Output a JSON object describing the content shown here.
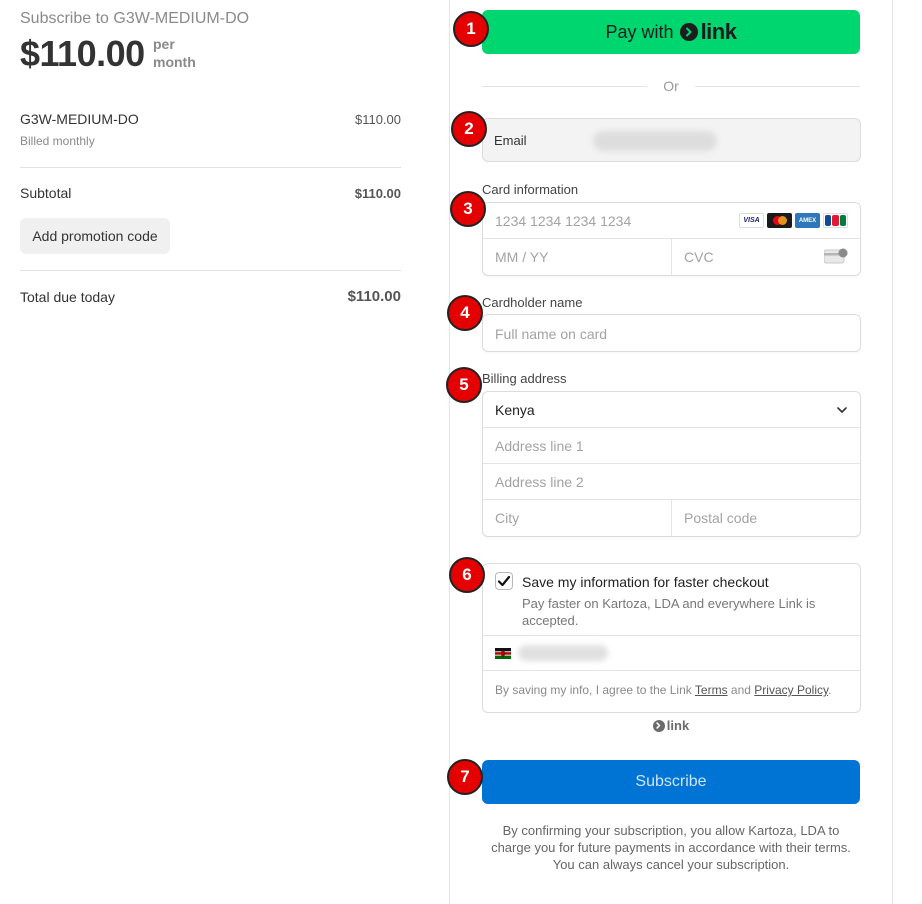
{
  "summary": {
    "subscribe_title": "Subscribe to G3W-MEDIUM-DO",
    "price": "$110.00",
    "per_line1": "per",
    "per_line2": "month",
    "item_name": "G3W-MEDIUM-DO",
    "item_billed": "Billed monthly",
    "item_amount": "$110.00",
    "subtotal_label": "Subtotal",
    "subtotal_amount": "$110.00",
    "promo_button": "Add promotion code",
    "total_label": "Total due today",
    "total_amount": "$110.00"
  },
  "payment": {
    "pay_with": "Pay with",
    "link_word": "link",
    "or_text": "Or",
    "email_label": "Email",
    "card_label": "Card information",
    "card_number_placeholder": "1234 1234 1234 1234",
    "expiry_placeholder": "MM / YY",
    "cvc_placeholder": "CVC",
    "card_brands": [
      "VISA",
      "mastercard",
      "AMEX",
      "JCB"
    ],
    "cardholder_label": "Cardholder name",
    "cardholder_placeholder": "Full name on card",
    "billing_label": "Billing address",
    "country_value": "Kenya",
    "address1_placeholder": "Address line 1",
    "address2_placeholder": "Address line 2",
    "city_placeholder": "City",
    "postal_placeholder": "Postal code",
    "save_checked": true,
    "save_title": "Save my information for faster checkout",
    "save_desc": "Pay faster on Kartoza, LDA and everywhere Link is accepted.",
    "agree_prefix": "By saving my info, I agree to the Link",
    "terms_link": "Terms",
    "agree_and": "and",
    "privacy_link": "Privacy Policy",
    "agree_suffix": ".",
    "footer_link_word": "link",
    "subscribe_button": "Subscribe",
    "confirm_text": "By confirming your subscription, you allow Kartoza, LDA to charge you for future payments in accordance with their terms. You can always cancel your subscription."
  },
  "markers": [
    "1",
    "2",
    "3",
    "4",
    "5",
    "6",
    "7"
  ],
  "colors": {
    "link_green": "#00d66f",
    "subscribe_blue": "#0074d4",
    "marker_red": "#e40000"
  },
  "icons": [
    "link-logo-icon",
    "visa-icon",
    "mastercard-icon",
    "amex-icon",
    "jcb-icon",
    "cvc-card-icon",
    "chevron-down-icon",
    "checkmark-icon",
    "kenya-flag-icon"
  ]
}
